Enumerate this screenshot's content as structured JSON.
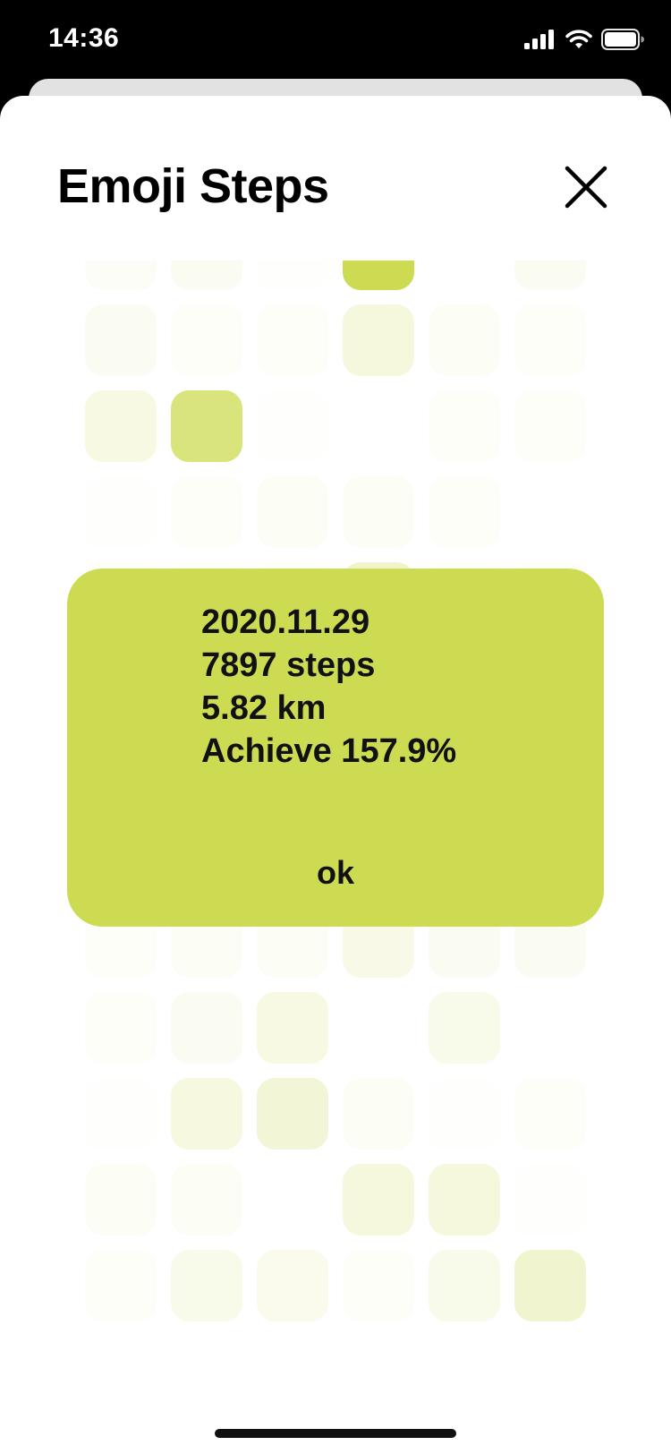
{
  "status_bar": {
    "time": "14:36",
    "icons": [
      "cellular-signal-icon",
      "wifi-icon",
      "battery-icon"
    ]
  },
  "sheet": {
    "title": "Emoji Steps",
    "close_icon": "close-icon"
  },
  "colors": {
    "accent": "#ccdb52",
    "sheet_back": "#e2e2e2",
    "status_bar_bg": "#000000",
    "text": "#000000"
  },
  "step_grid": {
    "columns": 6,
    "cell_opacity_levels": [
      [
        0.05,
        0.08,
        0.02,
        1.0,
        0.0,
        0.08
      ],
      [
        0.08,
        0.04,
        0.04,
        0.2,
        0.06,
        0.04
      ],
      [
        0.16,
        0.75,
        0.02,
        0.0,
        0.04,
        0.04
      ],
      [
        0.02,
        0.04,
        0.06,
        0.06,
        0.04,
        0.0
      ],
      [
        0.04,
        0.04,
        0.04,
        0.3,
        0.04,
        0.04
      ],
      [
        0.08,
        0.06,
        0.04,
        0.1,
        0.06,
        0.04
      ],
      [
        0.04,
        0.06,
        0.04,
        0.08,
        0.04,
        0.04
      ],
      [
        0.04,
        0.06,
        0.02,
        0.14,
        0.06,
        0.06
      ],
      [
        0.04,
        0.06,
        0.06,
        0.14,
        0.08,
        0.08
      ],
      [
        0.04,
        0.08,
        0.16,
        0.0,
        0.12,
        0.0
      ],
      [
        0.02,
        0.18,
        0.24,
        0.06,
        0.02,
        0.04
      ],
      [
        0.06,
        0.06,
        0.0,
        0.2,
        0.2,
        0.02
      ],
      [
        0.04,
        0.12,
        0.1,
        0.04,
        0.12,
        0.28
      ]
    ]
  },
  "dialog": {
    "date": "2020.11.29",
    "steps": "7897 steps",
    "distance": "5.82 km",
    "achieve": "Achieve 157.9%",
    "ok_label": "ok"
  }
}
